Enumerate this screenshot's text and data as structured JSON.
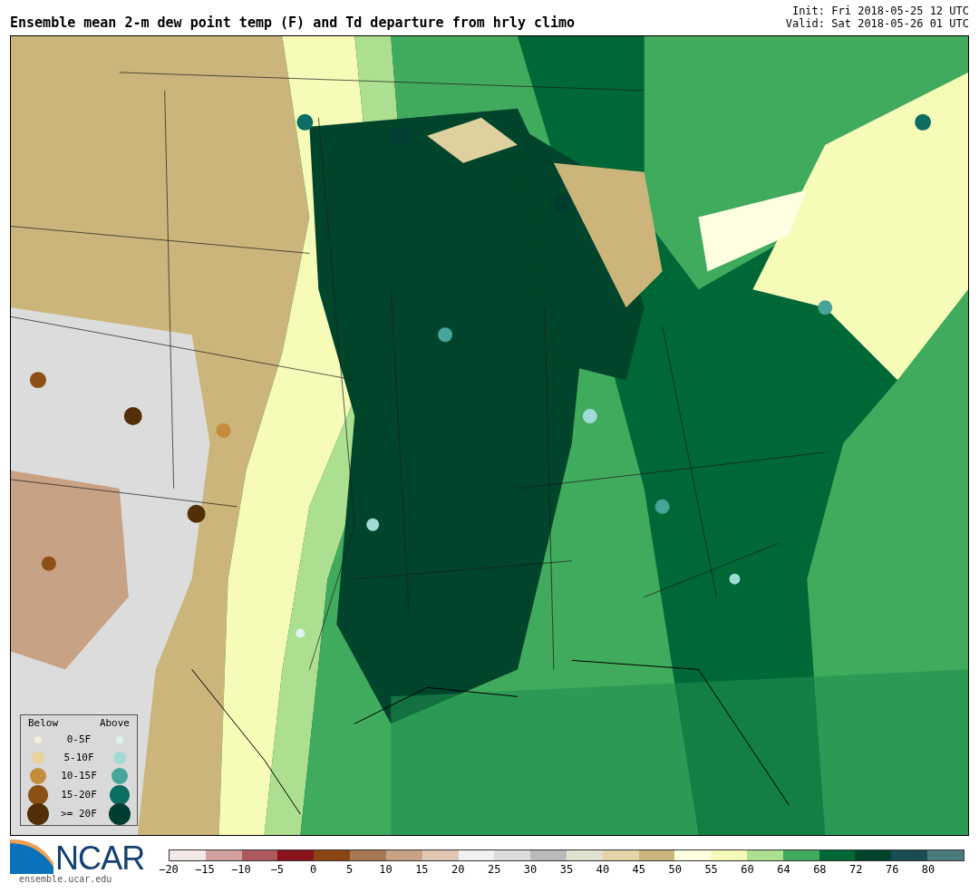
{
  "title": "Ensemble mean 2-m dew point temp (F) and Td departure from hrly climo",
  "init": "Init: Fri 2018-05-25 12 UTC",
  "valid": "Valid: Sat 2018-05-26 01 UTC",
  "legend": {
    "below_heading": "Below",
    "above_heading": "Above",
    "rows": [
      {
        "label": "0-5F",
        "below": {
          "color": "#f5ecd7"
        },
        "above": {
          "color": "#e0f3f3"
        }
      },
      {
        "label": "5-10F",
        "below": {
          "color": "#e9d29b"
        },
        "above": {
          "color": "#a0dcd5"
        }
      },
      {
        "label": "10-15F",
        "below": {
          "color": "#c68c3e"
        },
        "above": {
          "color": "#45a59a"
        }
      },
      {
        "label": "15-20F",
        "below": {
          "color": "#8b5114"
        },
        "above": {
          "color": "#0c6d63"
        }
      },
      {
        "label": ">= 20F",
        "below": {
          "color": "#532f08"
        },
        "above": {
          "color": "#003c30"
        }
      }
    ]
  },
  "logo": {
    "text": "NCAR",
    "url": "ensemble.ucar.edu"
  },
  "colorbar": {
    "segments": [
      {
        "color": "#f3e8e8"
      },
      {
        "color": "#d09fa0"
      },
      {
        "color": "#ae5a5e"
      },
      {
        "color": "#8b141c"
      },
      {
        "color": "#8b4513"
      },
      {
        "color": "#a97955"
      },
      {
        "color": "#c8a285"
      },
      {
        "color": "#e0c8b5"
      },
      {
        "color": "#f1f1f1"
      },
      {
        "color": "#dcdcdc"
      },
      {
        "color": "#bababa"
      },
      {
        "color": "#e1e2d2"
      },
      {
        "color": "#e5d5a9"
      },
      {
        "color": "#cbb57a"
      },
      {
        "color": "#fefee0"
      },
      {
        "color": "#f7fbb8"
      },
      {
        "color": "#addf91"
      },
      {
        "color": "#40aa5d"
      },
      {
        "color": "#006837"
      },
      {
        "color": "#00452b"
      },
      {
        "color": "#1a4c54"
      },
      {
        "color": "#4a7a7b"
      }
    ],
    "ticks": [
      "−20",
      "−15",
      "−10",
      "−5",
      "0",
      "5",
      "10",
      "15",
      "20",
      "25",
      "30",
      "35",
      "40",
      "45",
      "50",
      "55",
      "60",
      "64",
      "68",
      "72",
      "76",
      "80"
    ]
  }
}
